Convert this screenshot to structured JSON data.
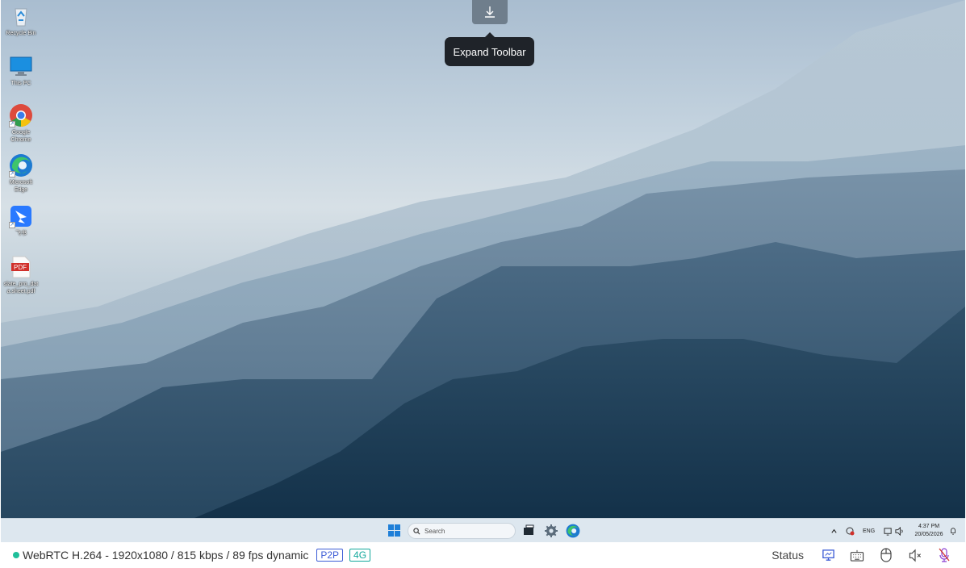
{
  "toolbar": {
    "expand_icon": "download-arrow-icon",
    "tooltip": "Expand Toolbar"
  },
  "desktop_icons": [
    {
      "label": "Recycle Bin",
      "icon": "recycle-bin-icon"
    },
    {
      "label": "This PC",
      "icon": "monitor-icon"
    },
    {
      "label": "Google Chrome",
      "icon": "chrome-icon"
    },
    {
      "label": "Microsoft Edge",
      "icon": "edge-icon"
    },
    {
      "label": "飞书",
      "icon": "feishu-icon"
    },
    {
      "label": "slate_pro_dat a.sheet.pdf",
      "icon": "pdf-icon",
      "badge": "PDF"
    }
  ],
  "taskbar": {
    "search_placeholder": "Search",
    "language": "ENG",
    "time": "4:37 PM",
    "date": "20/05/2026"
  },
  "statusbar": {
    "connection": "WebRTC H.264 - 1920x1080 /  815 kbps / 89 fps dynamic",
    "badge_p2p": "P2P",
    "badge_4g": "4G",
    "status_label": "Status"
  },
  "colors": {
    "accent_blue": "#3b5bd6",
    "accent_teal": "#12a89c",
    "connected": "#1fbf9a"
  }
}
